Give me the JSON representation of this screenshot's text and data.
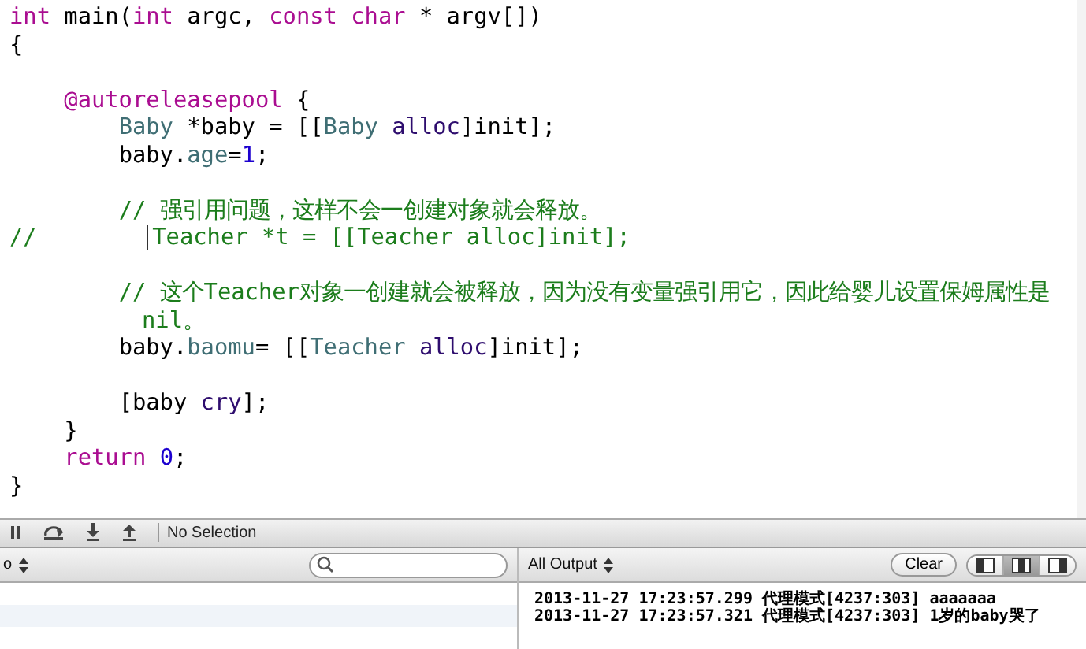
{
  "editor": {
    "lines": [
      {
        "kind": "code",
        "tokens": [
          {
            "text": "int",
            "kind": "keyword"
          },
          {
            "text": " main(",
            "kind": "plain"
          },
          {
            "text": "int",
            "kind": "keyword"
          },
          {
            "text": " argc, ",
            "kind": "plain"
          },
          {
            "text": "const ",
            "kind": "keyword"
          },
          {
            "text": "char",
            "kind": "keyword"
          },
          {
            "text": " * argv[])",
            "kind": "plain"
          }
        ]
      },
      {
        "kind": "code",
        "tokens": [
          {
            "text": "{",
            "kind": "plain"
          }
        ]
      },
      {
        "kind": "blank"
      },
      {
        "kind": "code",
        "tokens": [
          {
            "text": "    @autoreleasepool",
            "kind": "keyword"
          },
          {
            "text": " {",
            "kind": "plain"
          }
        ]
      },
      {
        "kind": "code",
        "tokens": [
          {
            "text": "        Baby",
            "kind": "type"
          },
          {
            "text": " *baby = [[",
            "kind": "plain"
          },
          {
            "text": "Baby ",
            "kind": "type"
          },
          {
            "text": "alloc",
            "kind": "method"
          },
          {
            "text": "]init];",
            "kind": "plain"
          }
        ]
      },
      {
        "kind": "code",
        "tokens": [
          {
            "text": "        baby.",
            "kind": "plain"
          },
          {
            "text": "age",
            "kind": "type"
          },
          {
            "text": "=",
            "kind": "plain"
          },
          {
            "text": "1",
            "kind": "number"
          },
          {
            "text": ";",
            "kind": "plain"
          }
        ]
      },
      {
        "kind": "blank"
      },
      {
        "kind": "code",
        "tokens": [
          {
            "text": "        // 强引用问题，这样不会一创建对象就会释放。",
            "kind": "comment"
          }
        ]
      },
      {
        "kind": "code",
        "tokens": [
          {
            "text": "//        ",
            "kind": "comment"
          },
          {
            "kind": "cursor"
          },
          {
            "text": "Teacher *t = [[Teacher alloc]init];",
            "kind": "comment"
          }
        ]
      },
      {
        "kind": "blank"
      },
      {
        "kind": "code",
        "tokens": [
          {
            "text": "        // 这个Teacher对象一创建就会被释放，因为没有变量强引用它，因此给婴儿设置保姆属性是nil。",
            "kind": "comment"
          }
        ]
      },
      {
        "kind": "code",
        "tokens": [
          {
            "text": "        baby.",
            "kind": "plain"
          },
          {
            "text": "baomu",
            "kind": "type"
          },
          {
            "text": "= [[",
            "kind": "plain"
          },
          {
            "text": "Teacher ",
            "kind": "type"
          },
          {
            "text": "alloc",
            "kind": "method"
          },
          {
            "text": "]init];",
            "kind": "plain"
          }
        ]
      },
      {
        "kind": "blank"
      },
      {
        "kind": "code",
        "tokens": [
          {
            "text": "        [baby ",
            "kind": "plain"
          },
          {
            "text": "cry",
            "kind": "method"
          },
          {
            "text": "];",
            "kind": "plain"
          }
        ]
      },
      {
        "kind": "code",
        "tokens": [
          {
            "text": "    }",
            "kind": "plain"
          }
        ]
      },
      {
        "kind": "code",
        "tokens": [
          {
            "text": "    return ",
            "kind": "keyword"
          },
          {
            "text": "0",
            "kind": "number"
          },
          {
            "text": ";",
            "kind": "plain"
          }
        ]
      },
      {
        "kind": "code",
        "tokens": [
          {
            "text": "}",
            "kind": "plain"
          }
        ]
      }
    ]
  },
  "debug_bar": {
    "buttons": [
      {
        "kind": "pause"
      },
      {
        "kind": "step-over"
      },
      {
        "kind": "step-into"
      },
      {
        "kind": "step-out"
      }
    ],
    "status": "No Selection"
  },
  "variables_view": {
    "scope_popup": "o"
  },
  "console": {
    "filter_popup": "All Output",
    "clear_button": "Clear",
    "view_toggles": [
      {
        "kind": "left",
        "selected": false
      },
      {
        "kind": "both",
        "selected": true
      },
      {
        "kind": "right",
        "selected": false
      }
    ],
    "lines": [
      "2013-11-27 17:23:57.299 代理模式[4237:303] aaaaaaa",
      "2013-11-27 17:23:57.321 代理模式[4237:303] 1岁的baby哭了"
    ]
  }
}
